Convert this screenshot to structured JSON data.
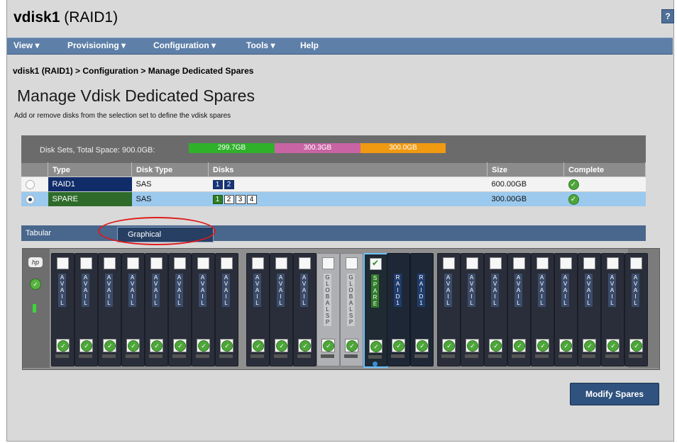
{
  "window": {
    "title_bold": "vdisk1",
    "title_rest": "(RAID1)",
    "help_label": "?"
  },
  "menu": {
    "items": [
      "View ▾",
      "Provisioning ▾",
      "Configuration ▾",
      "Tools ▾",
      "Help"
    ]
  },
  "breadcrumb": "vdisk1 (RAID1) > Configuration > Manage Dedicated Spares",
  "page": {
    "title": "Manage Vdisk Dedicated Spares",
    "subtitle": "Add or remove disks from the selection set to define the vdisk spares"
  },
  "disk_sets": {
    "label": "Disk Sets, Total Space: 900.0GB:",
    "segments": [
      {
        "label": "299.7GB",
        "color": "#2fb12a"
      },
      {
        "label": "300.3GB",
        "color": "#c864a4"
      },
      {
        "label": "300.0GB",
        "color": "#f09a12"
      }
    ]
  },
  "table": {
    "headers": [
      "Type",
      "Disk Type",
      "Disks",
      "Size",
      "Complete"
    ],
    "rows": [
      {
        "type": "RAID1",
        "disk_type": "SAS",
        "disks": [
          "1",
          "2"
        ],
        "size": "600.00GB",
        "selected": false
      },
      {
        "type": "SPARE",
        "disk_type": "SAS",
        "disks": [
          "1",
          "2",
          "3",
          "4"
        ],
        "size": "300.00GB",
        "selected": true
      }
    ]
  },
  "tabs": {
    "tabular": "Tabular",
    "graphical": "Graphical"
  },
  "enclosure": {
    "slot_labels": [
      "AVAIL",
      "AVAIL",
      "AVAIL",
      "AVAIL",
      "AVAIL",
      "AVAIL",
      "AVAIL",
      "AVAIL",
      "AVAIL",
      "AVAIL",
      "AVAIL",
      "GLOBALSP",
      "GLOBALSP",
      "SPARE",
      "RAID1",
      "RAID1",
      "AVAIL",
      "AVAIL",
      "AVAIL",
      "AVAIL",
      "AVAIL",
      "AVAIL",
      "AVAIL",
      "AVAIL",
      "AVAIL"
    ]
  },
  "actions": {
    "modify_label": "Modify Spares"
  }
}
